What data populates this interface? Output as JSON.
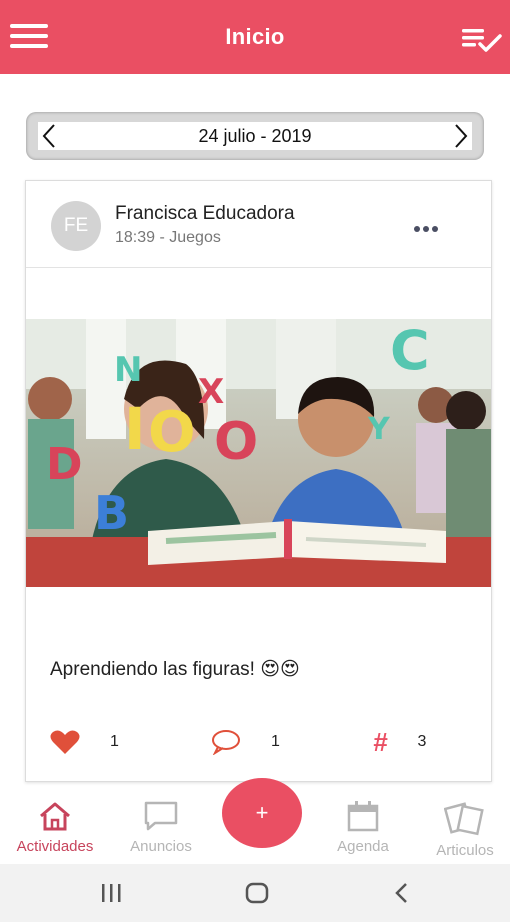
{
  "header": {
    "title": "Inicio",
    "menu_icon": "hamburger-menu-icon",
    "right_icon": "checklist-icon",
    "background": "#ea4f63"
  },
  "date_selector": {
    "date": "24 julio - 2019"
  },
  "post": {
    "avatar_initials": "FE",
    "author": "Francisca Educadora",
    "meta": "18:39 - Juegos",
    "caption": "Aprendiendo las figuras! 😍😍",
    "likes": "1",
    "comments": "1",
    "tags": "3",
    "tag_symbol": "#",
    "image": "photo of teacher and child reading a book with foam letters"
  },
  "bottom_nav": {
    "items": [
      {
        "label": "Actividades",
        "icon": "home-icon",
        "active": true
      },
      {
        "label": "Anuncios",
        "icon": "speech-bubble-icon",
        "active": false
      },
      {
        "label": "Agenda",
        "icon": "calendar-icon",
        "active": false
      },
      {
        "label": "Articulos",
        "icon": "documents-icon",
        "active": false
      }
    ],
    "fab_label": "+"
  },
  "colors": {
    "accent": "#ea4f63",
    "active_nav": "#c7445c",
    "inactive_nav": "#b5b5b5"
  }
}
